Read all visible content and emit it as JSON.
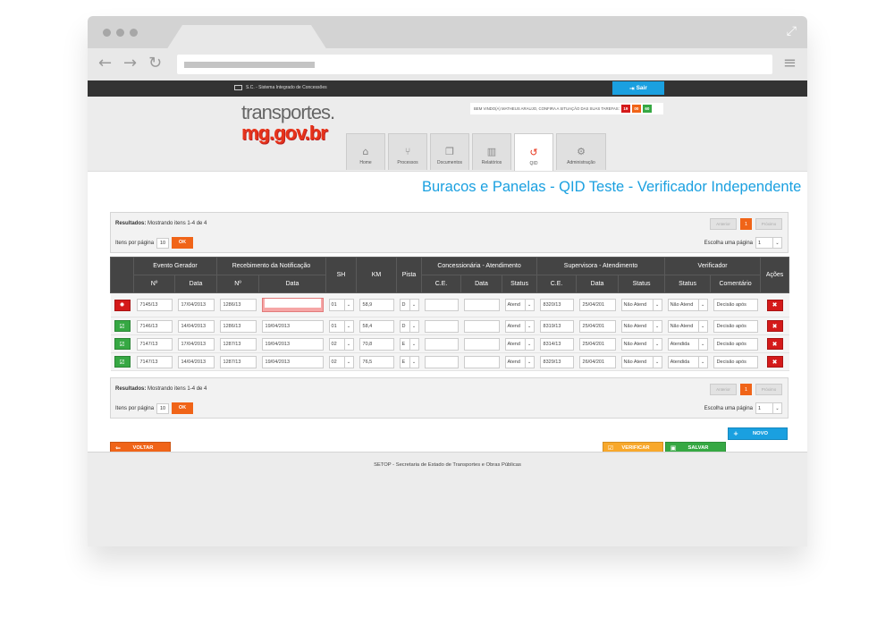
{
  "browser": {
    "dots": [
      "",
      "",
      ""
    ],
    "expand_icon": "expand-icon",
    "back_icon": "←",
    "forward_icon": "→",
    "reload_icon": "↻",
    "menu_icon": "≡"
  },
  "topbar": {
    "system_name": "S.C. - Sistema Integrado de Concessões",
    "logout_label": "Sair"
  },
  "header": {
    "logo_line1": "transportes.",
    "logo_line2": "mg.gov.br",
    "welcome_text": "BEM VINDO(A) MATHEUS ARAUJO, CONFIRA A SITUAÇÃO DAS SUAS TAREFAS:",
    "task_counts": {
      "red": "19",
      "orange": "00",
      "green": "60"
    },
    "tabs": [
      {
        "label": "Home",
        "icon": "⌂"
      },
      {
        "label": "Processos",
        "icon": "⑂"
      },
      {
        "label": "Documentos",
        "icon": "❐"
      },
      {
        "label": "Relatórios",
        "icon": "▥"
      },
      {
        "label": "QID",
        "icon": "↺"
      },
      {
        "label": "Administração",
        "icon": "⚙"
      }
    ]
  },
  "page_title": "Buracos e Panelas - QID Teste - Verificador Independente",
  "pager": {
    "results_label": "Resultados:",
    "results_text": "Mostrando itens 1-4 de 4",
    "items_per_page_label": "Itens por página",
    "items_per_page": "10",
    "ok_label": "OK",
    "prev_label": "Anterior",
    "current_page": "1",
    "next_label": "Próximo",
    "choose_page_label": "Escolha uma página",
    "choose_page_value": "1"
  },
  "table": {
    "group_headers": [
      "Evento Gerador",
      "Recebimento da Notificação",
      "SH",
      "KM",
      "Pista",
      "Concessionária - Atendimento",
      "Supervisora - Atendimento",
      "Verificador",
      "Ações"
    ],
    "sub_headers": [
      "Nº",
      "Data",
      "Nº",
      "Data",
      "C.E.",
      "Data",
      "Status",
      "C.E.",
      "Data",
      "Status",
      "Status",
      "Comentário"
    ],
    "rows": [
      {
        "status": "error",
        "evento_no": "7145/13",
        "evento_data": "17/04/2013",
        "receb_no": "1286/13",
        "receb_data": "",
        "sh": "01",
        "km": "58,9",
        "pista": "D",
        "conc_ce": "",
        "conc_data": "",
        "conc_status": "Atend",
        "sup_ce": "8320/13",
        "sup_data": "25/04/201",
        "sup_status": "Não Atend",
        "ver_status": "Não Atend",
        "comentario": "Decisão após"
      },
      {
        "status": "ok",
        "evento_no": "7146/13",
        "evento_data": "14/04/2013",
        "receb_no": "1286/13",
        "receb_data": "19/04/2013",
        "sh": "01",
        "km": "58,4",
        "pista": "D",
        "conc_ce": "",
        "conc_data": "",
        "conc_status": "Atend",
        "sup_ce": "8319/13",
        "sup_data": "25/04/201",
        "sup_status": "Não Atend",
        "ver_status": "Não Atend",
        "comentario": "Decisão após"
      },
      {
        "status": "ok",
        "evento_no": "7147/13",
        "evento_data": "17/04/2013",
        "receb_no": "1287/13",
        "receb_data": "19/04/2013",
        "sh": "02",
        "km": "70,8",
        "pista": "E",
        "conc_ce": "",
        "conc_data": "",
        "conc_status": "Atend",
        "sup_ce": "8314/13",
        "sup_data": "25/04/201",
        "sup_status": "Não Atend",
        "ver_status": "Atendida",
        "comentario": "Decisão após"
      },
      {
        "status": "ok",
        "evento_no": "7147/13",
        "evento_data": "14/04/2013",
        "receb_no": "1287/13",
        "receb_data": "19/04/2013",
        "sh": "02",
        "km": "76,5",
        "pista": "E",
        "conc_ce": "",
        "conc_data": "",
        "conc_status": "Atend",
        "sup_ce": "8329/13",
        "sup_data": "26/04/201",
        "sup_status": "Não Atend",
        "ver_status": "Atendida",
        "comentario": "Decisão após"
      }
    ]
  },
  "actions": {
    "novo_label": "NOVO",
    "voltar_label": "VOLTAR",
    "verificar_label": "VERIFICAR",
    "salvar_label": "SALVAR"
  },
  "footer": {
    "text": "SETOP - Secretaria de Estado de Transportes e Obras Públicas"
  },
  "colors": {
    "accent_blue": "#1aa0e0",
    "accent_orange": "#f06418",
    "green": "#36a843",
    "red": "#d41a1a",
    "dark_header": "#444444"
  }
}
